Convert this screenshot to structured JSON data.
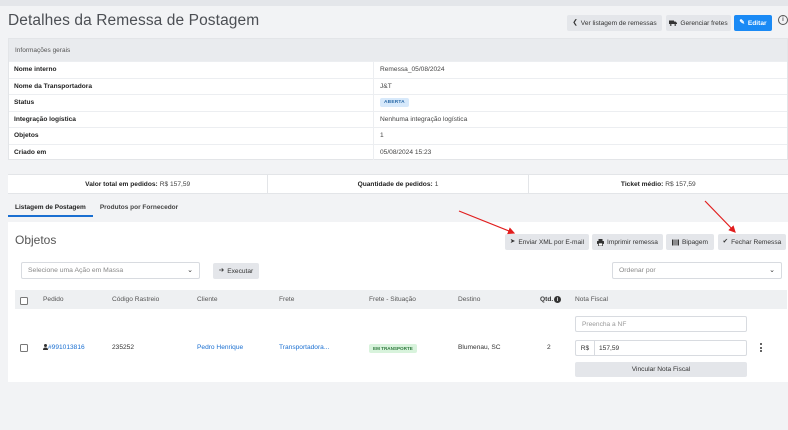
{
  "page_title": "Detalhes da Remessa de Postagem",
  "header_buttons": {
    "listagem": "Ver listagem de remessas",
    "fretes": "Gerenciar fretes",
    "editar": "Editar"
  },
  "info": {
    "heading": "Informações gerais",
    "rows": [
      {
        "label": "Nome interno",
        "value": "Remessa_05/08/2024"
      },
      {
        "label": "Nome da Transportadora",
        "value": "J&T"
      },
      {
        "label": "Status",
        "value": "ABERTA"
      },
      {
        "label": "Integração logística",
        "value": "Nenhuma integração logística"
      },
      {
        "label": "Objetos",
        "value": "1"
      },
      {
        "label": "Criado em",
        "value": "05/08/2024 15:23"
      }
    ]
  },
  "stats": {
    "valor_label": "Valor total em pedidos:",
    "valor": "R$ 157,59",
    "qtd_label": "Quantidade de pedidos:",
    "qtd": "1",
    "ticket_label": "Ticket médio:",
    "ticket": "R$ 157,59"
  },
  "tabs": [
    "Listagem de Postagem",
    "Produtos por Fornecedor"
  ],
  "objetos": {
    "title": "Objetos",
    "actions": {
      "xml": "Enviar XML por E-mail",
      "imprimir": "Imprimir remessa",
      "bipagem": "Bipagem",
      "fechar": "Fechar Remessa"
    },
    "bulk_placeholder": "Selecione uma Ação em Massa",
    "executar": "Executar",
    "ordenar_placeholder": "Ordenar por",
    "columns": {
      "pedido": "Pedido",
      "codigo": "Código Rastreio",
      "cliente": "Cliente",
      "frete": "Frete",
      "situacao": "Frete - Situação",
      "destino": "Destino",
      "qtd": "Qtd.",
      "nf": "Nota Fiscal"
    },
    "row": {
      "pedido": "#991013816",
      "codigo": "235252",
      "cliente": "Pedro Henrique",
      "frete": "Transportadora...",
      "situacao": "EM TRANSPORTE",
      "destino": "Blumenau, SC",
      "qtd": "2",
      "nf_placeholder": "Preencha a NF",
      "currency": "R$",
      "valor": "157,59",
      "vincular": "Vincular Nota Fiscal"
    }
  },
  "colors": {
    "primary": "#1a8af5",
    "link": "#1a6fd1",
    "annotation_arrow": "#e11d1d",
    "badge_aberta_bg": "#d7e9fb",
    "badge_transporte_bg": "#d8f3dc"
  }
}
